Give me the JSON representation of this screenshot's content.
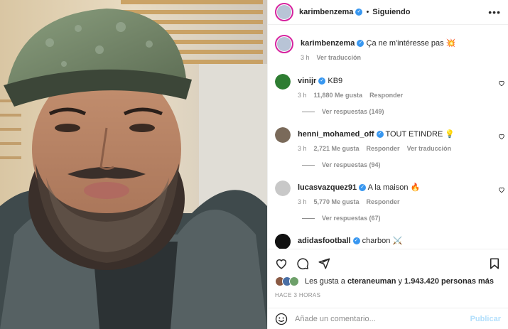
{
  "post": {
    "author": "karimbenzema",
    "follow_status": "Siguiendo",
    "caption": "Ça ne m'intéresse pas",
    "caption_emoji": "💥",
    "caption_time": "3 h",
    "see_translation": "Ver traducción"
  },
  "comments": [
    {
      "user": "vinijr",
      "text": "KB9",
      "time": "3 h",
      "likes": "11,880 Me gusta",
      "reply": "Responder",
      "translate": "",
      "replies": "Ver respuestas (149)",
      "avatar_color": "#2e7d32"
    },
    {
      "user": "henni_mohamed_off",
      "text": "TOUT ETINDRE",
      "emoji": "💡",
      "time": "3 h",
      "likes": "2,721 Me gusta",
      "reply": "Responder",
      "translate": "Ver traducción",
      "replies": "Ver respuestas (94)",
      "avatar_color": "#7a6a5a"
    },
    {
      "user": "lucasvazquez91",
      "text": "A la maison",
      "emoji": "🔥",
      "time": "3 h",
      "likes": "5,770 Me gusta",
      "reply": "Responder",
      "translate": "",
      "replies": "Ver respuestas (67)",
      "avatar_color": "#c8c8c8"
    },
    {
      "user": "adidasfootball",
      "text": "charbon",
      "emoji": "⚔️",
      "time": "",
      "likes": "",
      "reply": "",
      "translate": "",
      "replies": "",
      "avatar_color": "#111111"
    }
  ],
  "likes": {
    "prefix": "Les gusta a",
    "user": "cteraneuman",
    "middle": "y",
    "count": "1.943.420 personas más"
  },
  "timestamp": "HACE 3 HORAS",
  "add_comment": {
    "placeholder": "Añade un comentario...",
    "publish": "Publicar"
  },
  "icons": {
    "like": "heart-icon",
    "comment": "comment-icon",
    "share": "paper-plane-icon",
    "save": "bookmark-icon",
    "emoji": "smiley-icon",
    "more": "more-dots-icon"
  },
  "colors": {
    "verified": "#3897f0",
    "story_ring": "#d6249f",
    "publish_disabled": "#b2dffc",
    "secondary_text": "#8e8e8e"
  }
}
